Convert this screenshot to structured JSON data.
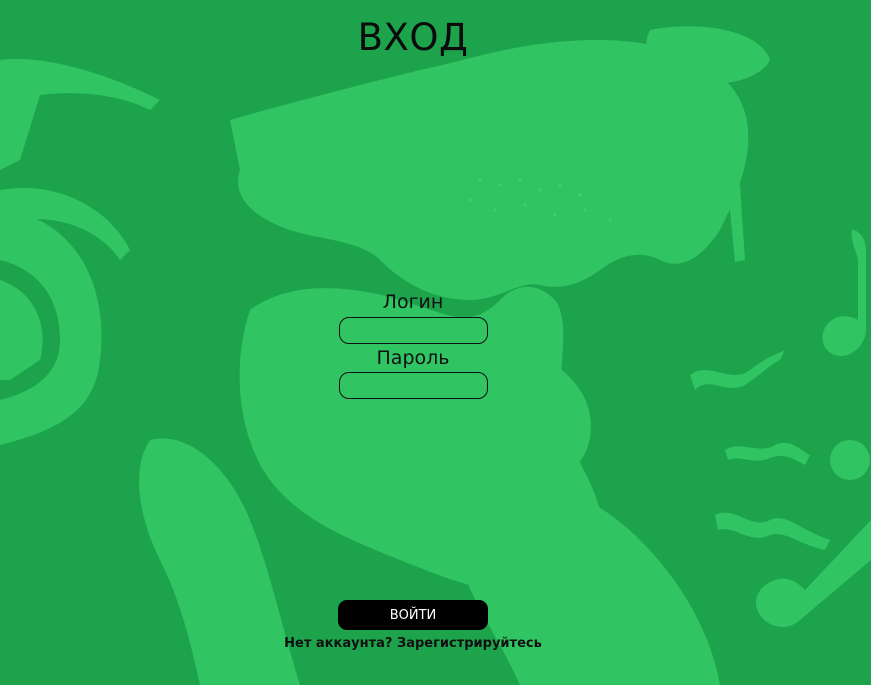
{
  "page": {
    "title": "ВХОД",
    "background_color": "#1ca34c",
    "shape_color": "#30c463"
  },
  "form": {
    "login_label": "Логин",
    "login_value": "",
    "password_label": "Пароль",
    "password_value": "",
    "submit_label": "ВОЙТИ"
  },
  "footer": {
    "no_account_text": "Нет аккаунта?",
    "register_link": "Зарегистрируйтесь"
  }
}
